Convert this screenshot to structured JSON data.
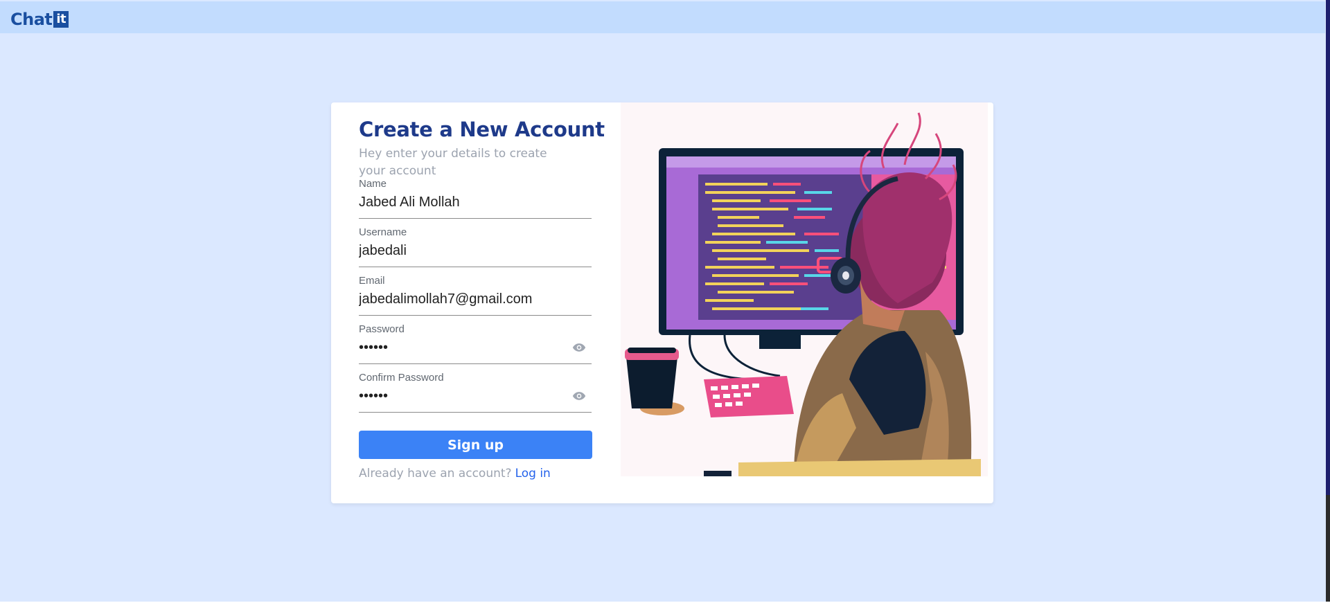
{
  "app": {
    "logo_text": "Chat",
    "logo_badge": "it"
  },
  "signup": {
    "title": "Create a New Account",
    "subtitle": "Hey enter your details to create your account",
    "fields": [
      {
        "label": "Name",
        "value": "Jabed Ali Mollah",
        "type": "text"
      },
      {
        "label": "Username",
        "value": "jabedali",
        "type": "text"
      },
      {
        "label": "Email",
        "value": "jabedalimollah7@gmail.com",
        "type": "email"
      },
      {
        "label": "Password",
        "value": "••••••",
        "type": "password",
        "icon": "eye-icon"
      },
      {
        "label": "Confirm Password",
        "value": "••••••",
        "type": "password",
        "icon": "eye-icon"
      }
    ],
    "submit_label": "Sign up",
    "login_prompt": "Already have an account?",
    "login_link": "Log in"
  },
  "illustration": {
    "subject": "developer-at-computer-illustration"
  },
  "colors": {
    "page_bg": "#dbe8ff",
    "topbar_bg": "#c2dcfe",
    "brand": "#1a4fa0",
    "title": "#1e3a8a",
    "button": "#3b82f6",
    "link": "#2563eb",
    "muted": "#9ca3af"
  }
}
